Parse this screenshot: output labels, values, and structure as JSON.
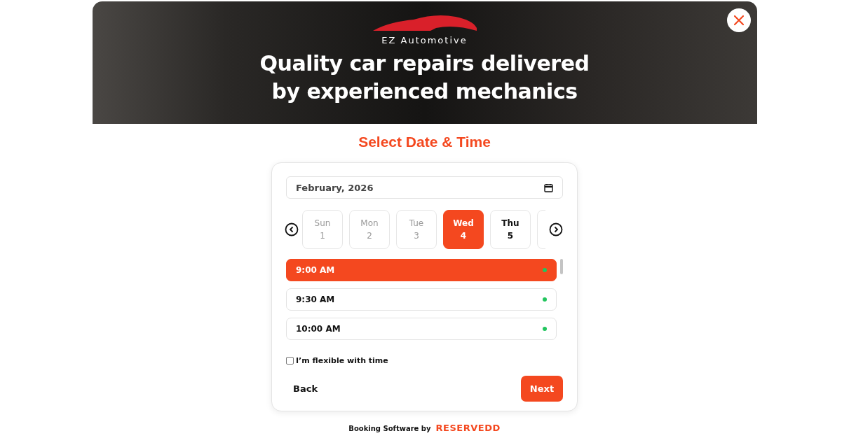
{
  "banner": {
    "brand": "EZ Automotive",
    "headline": "Quality car repairs delivered by experienced mechanics"
  },
  "title": "Select Date & Time",
  "month_field": {
    "value": "February, 2026"
  },
  "days": [
    {
      "weekday": "Sun",
      "date": "1",
      "disabled": true,
      "selected": false
    },
    {
      "weekday": "Mon",
      "date": "2",
      "disabled": true,
      "selected": false
    },
    {
      "weekday": "Tue",
      "date": "3",
      "disabled": true,
      "selected": false
    },
    {
      "weekday": "Wed",
      "date": "4",
      "disabled": false,
      "selected": true
    },
    {
      "weekday": "Thu",
      "date": "5",
      "disabled": false,
      "selected": false
    }
  ],
  "time_slots": [
    {
      "label": "9:00 AM",
      "selected": true,
      "color": "#22c55e"
    },
    {
      "label": "9:30 AM",
      "selected": false,
      "color": "#22c55e"
    },
    {
      "label": "10:00 AM",
      "selected": false,
      "color": "#22c55e"
    }
  ],
  "flexible": {
    "label": "I’m flexible with time",
    "checked": false
  },
  "buttons": {
    "back": "Back",
    "next": "Next"
  },
  "footer": {
    "text": "Booking Software by",
    "brand": "RESERVEDD"
  }
}
